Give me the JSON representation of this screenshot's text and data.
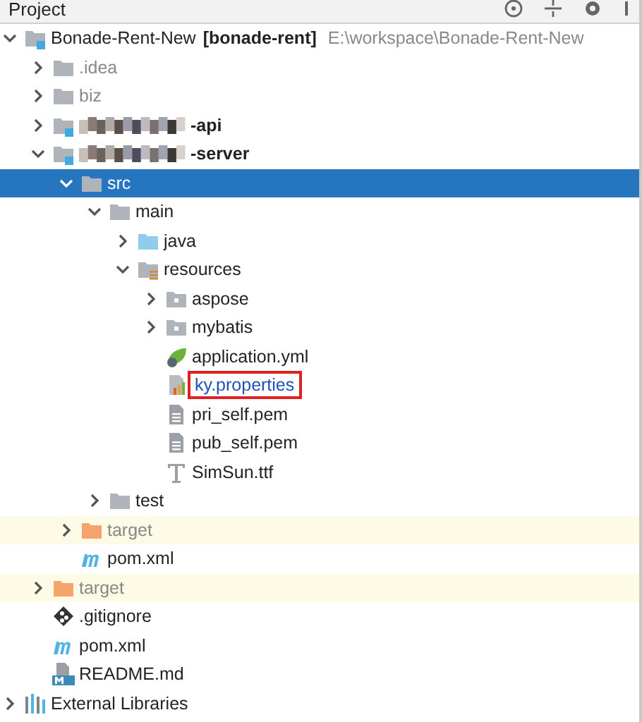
{
  "panel": {
    "title": "Project"
  },
  "tree": [
    {
      "label": "Bonade-Rent-New",
      "module_name": "[bonade-rent]",
      "path": "E:\\workspace\\Bonade-Rent-New",
      "kind": "module",
      "expanded": true,
      "selected": false,
      "children": [
        {
          "label": ".idea",
          "kind": "folder",
          "muted": true,
          "expanded": false,
          "selected": false
        },
        {
          "label": "biz",
          "kind": "folder",
          "muted": true,
          "expanded": false,
          "selected": false
        },
        {
          "label": "-api",
          "kind": "module",
          "bold": true,
          "redacted": true,
          "expanded": false,
          "selected": false
        },
        {
          "label": "-server",
          "kind": "module",
          "bold": true,
          "redacted": true,
          "expanded": true,
          "selected": false,
          "children": [
            {
              "label": "src",
              "kind": "folder",
              "expanded": true,
              "selected": true,
              "children": [
                {
                  "label": "main",
                  "kind": "folder",
                  "expanded": true,
                  "selected": false,
                  "children": [
                    {
                      "label": "java",
                      "kind": "source",
                      "expanded": false,
                      "selected": false
                    },
                    {
                      "label": "resources",
                      "kind": "resources",
                      "expanded": true,
                      "selected": false,
                      "children": [
                        {
                          "label": "aspose",
                          "kind": "package",
                          "expanded": false,
                          "selected": false
                        },
                        {
                          "label": "mybatis",
                          "kind": "package",
                          "expanded": false,
                          "selected": false
                        },
                        {
                          "label": "application.yml",
                          "kind": "spring",
                          "selected": false
                        },
                        {
                          "label": "ky.properties",
                          "kind": "properties",
                          "modified": true,
                          "outlined": true,
                          "selected": false
                        },
                        {
                          "label": "pri_self.pem",
                          "kind": "text",
                          "selected": false
                        },
                        {
                          "label": "pub_self.pem",
                          "kind": "text",
                          "selected": false
                        },
                        {
                          "label": "SimSun.ttf",
                          "kind": "font",
                          "selected": false
                        }
                      ]
                    }
                  ]
                },
                {
                  "label": "test",
                  "kind": "folder",
                  "expanded": false,
                  "selected": false
                }
              ]
            },
            {
              "label": "target",
              "kind": "excluded",
              "muted": true,
              "highlighted": true,
              "expanded": false,
              "selected": false
            },
            {
              "label": "pom.xml",
              "kind": "maven",
              "selected": false
            }
          ]
        },
        {
          "label": "target",
          "kind": "excluded",
          "muted": true,
          "highlighted": true,
          "expanded": false,
          "selected": false
        },
        {
          "label": ".gitignore",
          "kind": "git",
          "selected": false
        },
        {
          "label": "pom.xml",
          "kind": "maven",
          "selected": false
        },
        {
          "label": "README.md",
          "kind": "markdown",
          "selected": false
        }
      ]
    },
    {
      "label": "External Libraries",
      "kind": "libraries",
      "expanded": false,
      "selected": false
    }
  ]
}
